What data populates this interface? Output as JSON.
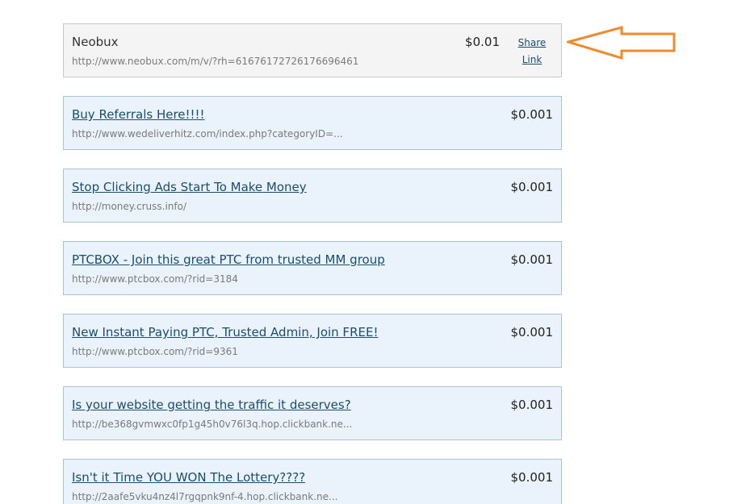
{
  "featured": {
    "title": "Neobux",
    "url": "http://www.neobux.com/m/v/?rh=61676172726176696461",
    "price": "$0.01",
    "share_line1": "Share",
    "share_line2": "Link"
  },
  "ads": [
    {
      "title": "Buy Referrals Here!!!!",
      "url": "http://www.wedeliverhitz.com/index.php?categoryID=...",
      "price": "$0.001"
    },
    {
      "title": "Stop Clicking Ads Start To Make Money",
      "url": "http://money.cruss.info/",
      "price": "$0.001"
    },
    {
      "title": "PTCBOX - Join this great PTC from trusted MM group",
      "url": "http://www.ptcbox.com/?rid=3184",
      "price": "$0.001"
    },
    {
      "title": "New Instant Paying PTC, Trusted Admin, Join FREE!",
      "url": "http://www.ptcbox.com/?rid=9361",
      "price": "$0.001"
    },
    {
      "title": "Is your website getting the traffic it deserves?",
      "url": "http://be368gvmwxc0fp1g45h0v76l3q.hop.clickbank.ne...",
      "price": "$0.001"
    },
    {
      "title": "Isn't it Time YOU WON The Lottery????",
      "url": "http://2aafe5vku4nz4l7rgqpnk9nf-4.hop.clickbank.ne...",
      "price": "$0.001"
    }
  ],
  "annotation": {
    "arrow_color": "#f08a2c"
  }
}
